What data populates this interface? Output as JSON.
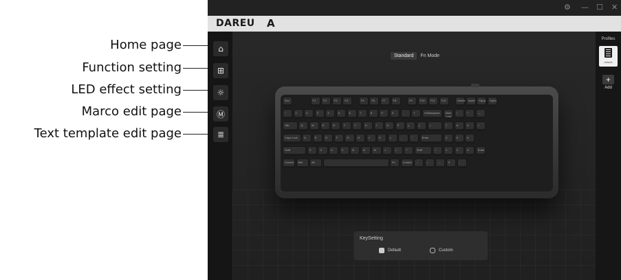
{
  "annotations": [
    {
      "label": "Home page"
    },
    {
      "label": "Function setting"
    },
    {
      "label": "LED effect setting"
    },
    {
      "label": "Marco edit page"
    },
    {
      "label": "Text template edit page"
    }
  ],
  "window": {
    "controls": {
      "settings": "⚙",
      "minimize": "—",
      "maximize": "☐",
      "close": "✕"
    }
  },
  "brand": {
    "logo_text": "DAREU",
    "logo_mark": "A"
  },
  "sidebar": {
    "items": [
      {
        "icon": "home-icon",
        "glyph": "⌂"
      },
      {
        "icon": "function-icon",
        "glyph": "⊞"
      },
      {
        "icon": "led-icon",
        "glyph": "☼"
      },
      {
        "icon": "macro-icon",
        "glyph": "Ⓜ"
      },
      {
        "icon": "text-template-icon",
        "glyph": "≣"
      }
    ]
  },
  "mode_tabs": {
    "standard": "Standard",
    "fn": "Fn Mode"
  },
  "keyboard": {
    "row1": [
      "Esc",
      "F1",
      "F2",
      "F3",
      "F4",
      "F5",
      "F6",
      "F7",
      "F8",
      "F9",
      "F10",
      "F11",
      "F12",
      "Delete",
      "Insert",
      "PgUp",
      "PgDn"
    ],
    "row2": [
      "~",
      "1",
      "2",
      "3",
      "4",
      "5",
      "6",
      "7",
      "8",
      "9",
      "0",
      "-",
      "+",
      "⇐Backspace",
      "Num Lock",
      "/",
      "*",
      "—"
    ],
    "row3": [
      "Tab",
      "Q",
      "W",
      "E",
      "R",
      "T",
      "Y",
      "U",
      "I",
      "O",
      "P",
      "{",
      "}",
      "|",
      "7",
      "8",
      "9",
      "+"
    ],
    "row4": [
      "Caps Lock",
      "A",
      "S",
      "D",
      "F",
      "G",
      "H",
      "J",
      "K",
      "L",
      ";",
      "\"",
      "Enter",
      "4",
      "5",
      "6"
    ],
    "row5": [
      "Shift",
      "Z",
      "X",
      "C",
      "V",
      "B",
      "N",
      "M",
      "<",
      ">",
      "?",
      "Shift",
      "↑",
      "1",
      "2",
      "3",
      "Enter"
    ],
    "row6": [
      "Control",
      "Win",
      "Alt",
      "",
      "Fn",
      "Control",
      "←",
      "↓",
      "→",
      "0",
      "."
    ]
  },
  "keysetting": {
    "title": "KeySetting",
    "default_label": "Default",
    "custom_label": "Custom",
    "selected": "Default"
  },
  "profiles": {
    "title": "Profiles",
    "items": [
      {
        "name": "default"
      }
    ],
    "add_label": "Add",
    "add_glyph": "+"
  }
}
